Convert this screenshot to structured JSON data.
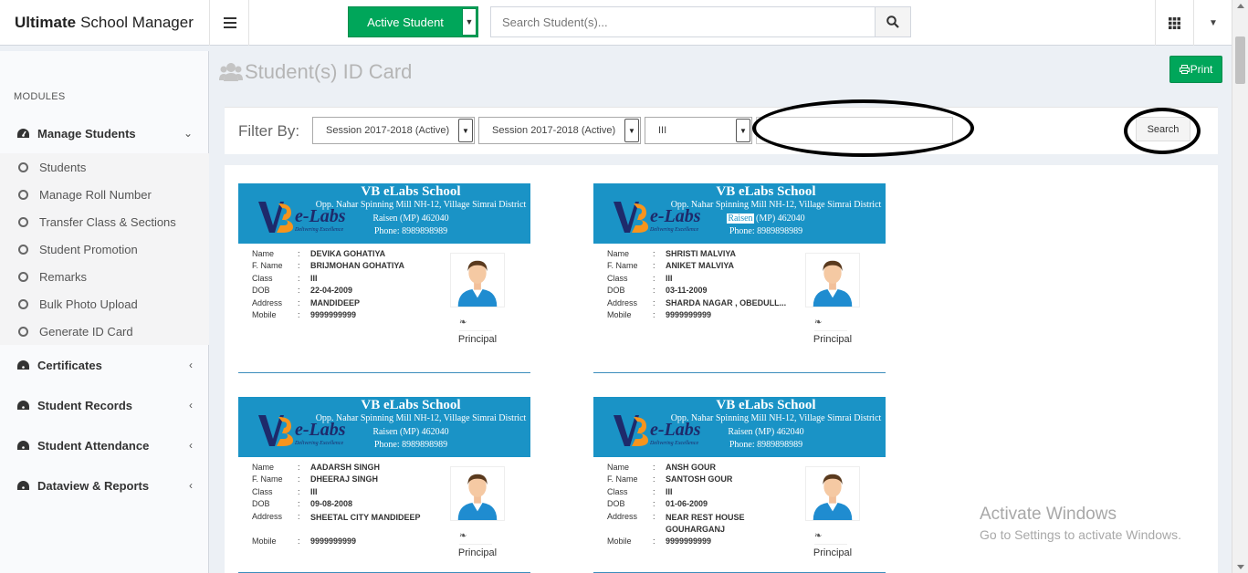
{
  "header": {
    "brand_bold": "Ultimate",
    "brand_rest": "School Manager",
    "active_button": "Active Student",
    "search_placeholder": "Search Student(s)..."
  },
  "sidebar": {
    "section_label": "MODULES",
    "manage_students": "Manage Students",
    "sub_items": [
      "Students",
      "Manage Roll Number",
      "Transfer Class & Sections",
      "Student Promotion",
      "Remarks",
      "Bulk Photo Upload",
      "Generate ID Card"
    ],
    "other_items": [
      "Certificates",
      "Student Records",
      "Student Attendance",
      "Dataview & Reports"
    ]
  },
  "page": {
    "title": "Student(s) ID Card",
    "print_label": "Print"
  },
  "filter": {
    "label": "Filter By:",
    "session1": "Session 2017-2018 (Active)",
    "session2": "Session 2017-2018 (Active)",
    "class_value": "III",
    "search_label": "Search"
  },
  "school": {
    "name": "VB eLabs School",
    "address_line1": "Opp. Nahar Spinning Mill NH-12, Village Simrai District",
    "city": "Raisen",
    "address_line2_rest": "(MP) 462040",
    "phone": "Phone: 8989898989",
    "logo_text": "e-Labs",
    "logo_tagline": "Delivering Excellence"
  },
  "field_labels": {
    "name": "Name",
    "fname": "F. Name",
    "class": "Class",
    "dob": "DOB",
    "address": "Address",
    "mobile": "Mobile",
    "colon": ":",
    "principal": "Principal"
  },
  "students": [
    {
      "name": "DEVIKA GOHATIYA",
      "fname": "BRIJMOHAN GOHATIYA",
      "class": "III",
      "dob": "22-04-2009",
      "address": "MANDIDEEP",
      "mobile": "9999999999"
    },
    {
      "name": "SHRISTI MALVIYA",
      "fname": "ANIKET MALVIYA",
      "class": "III",
      "dob": "03-11-2009",
      "address": "SHARDA NAGAR , OBEDULL...",
      "mobile": "9999999999"
    },
    {
      "name": "AADARSH SINGH",
      "fname": "DHEERAJ SINGH",
      "class": "III",
      "dob": "09-08-2008",
      "address": "SHEETAL CITY MANDIDEEP",
      "mobile": "9999999999"
    },
    {
      "name": "ANSH GOUR",
      "fname": "SANTOSH GOUR",
      "class": "III",
      "dob": "01-06-2009",
      "address": "NEAR REST HOUSE GOUHARGANJ",
      "mobile": "9999999999"
    }
  ],
  "watermark": {
    "line1": "Activate Windows",
    "line2": "Go to Settings to activate Windows."
  },
  "colors": {
    "accent_green": "#00a65a",
    "card_header_blue": "#1a93c6"
  }
}
